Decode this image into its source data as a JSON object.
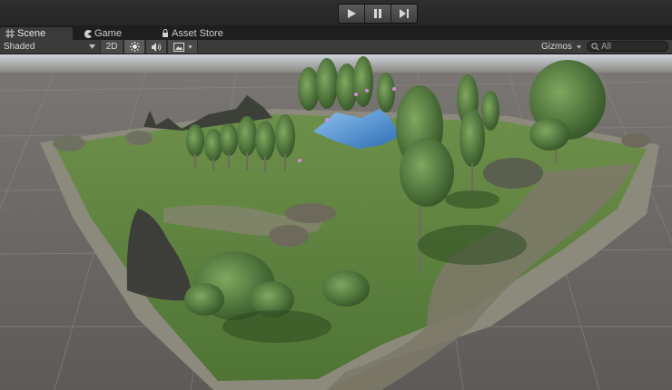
{
  "playbar": {
    "play_icon": "play-icon",
    "pause_icon": "pause-icon",
    "step_icon": "step-icon"
  },
  "tabs": [
    {
      "label": "Scene",
      "icon": "grid-icon",
      "active": true
    },
    {
      "label": "Game",
      "icon": "pacman-icon",
      "active": false
    },
    {
      "label": "Asset Store",
      "icon": "lock-icon",
      "active": false
    }
  ],
  "toolbar": {
    "shading_mode": "Shaded",
    "mode_2d": "2D",
    "lighting_icon": "sun-icon",
    "audio_icon": "speaker-icon",
    "effects_icon": "image-icon",
    "gizmos_label": "Gizmos",
    "search_placeholder": "All"
  },
  "colors": {
    "background": "#2b2b2b",
    "toolbar": "#3b3b3b",
    "grass": "#5d7f3e",
    "water": "#3f7fbf",
    "rock": "#4a4a48",
    "grid_floor": "#6e6a66"
  }
}
